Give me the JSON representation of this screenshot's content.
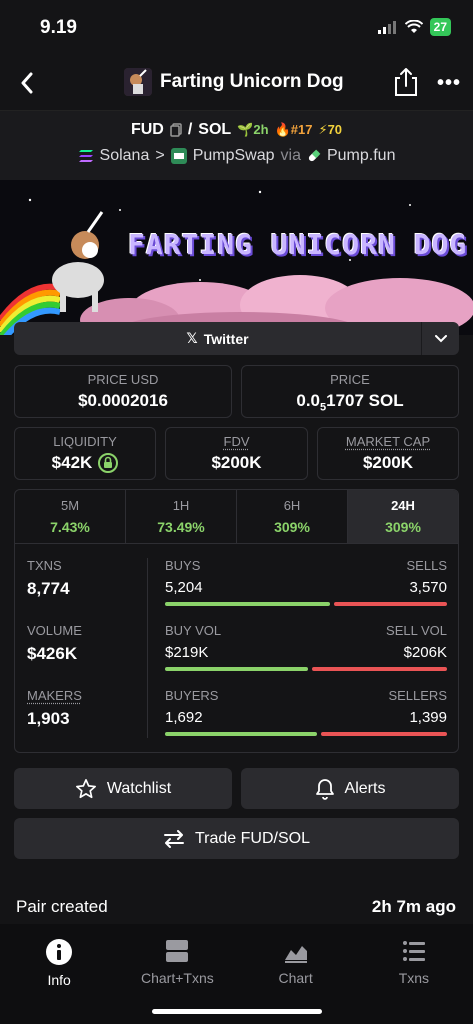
{
  "status": {
    "time": "9.19",
    "battery": "27"
  },
  "nav": {
    "title": "Farting Unicorn Dog"
  },
  "pair": {
    "base": "FUD",
    "sep": "/",
    "quote": "SOL",
    "age": "2h",
    "rank": "#17",
    "boosts": "70"
  },
  "chain": {
    "network": "Solana",
    "sep": ">",
    "dex": "PumpSwap",
    "via": "via",
    "launchpad": "Pump.fun"
  },
  "banner": {
    "text": "FARTING UNICORN DOG"
  },
  "twitter": {
    "label": "Twitter"
  },
  "price": {
    "usd_label": "PRICE USD",
    "usd_value": "$0.0002016",
    "native_label": "PRICE",
    "native_prefix": "0.0",
    "native_zeros": "5",
    "native_rest": "1707 SOL"
  },
  "metrics": {
    "liquidity_label": "LIQUIDITY",
    "liquidity_value": "$42K",
    "fdv_label": "FDV",
    "fdv_value": "$200K",
    "mcap_label": "MARKET CAP",
    "mcap_value": "$200K"
  },
  "timeframes": [
    {
      "label": "5M",
      "change": "7.43%"
    },
    {
      "label": "1H",
      "change": "73.49%"
    },
    {
      "label": "6H",
      "change": "309%"
    },
    {
      "label": "24H",
      "change": "309%"
    }
  ],
  "stats": {
    "txns_label": "TXNS",
    "txns_value": "8,774",
    "volume_label": "VOLUME",
    "volume_value": "$426K",
    "makers_label": "MAKERS",
    "makers_value": "1,903",
    "buys_label": "BUYS",
    "buys_value": "5,204",
    "sells_label": "SELLS",
    "sells_value": "3,570",
    "buyvol_label": "BUY VOL",
    "buyvol_value": "$219K",
    "sellvol_label": "SELL VOL",
    "sellvol_value": "$206K",
    "buyers_label": "BUYERS",
    "buyers_value": "1,692",
    "sellers_label": "SELLERS",
    "sellers_value": "1,399"
  },
  "actions": {
    "watchlist": "Watchlist",
    "alerts": "Alerts",
    "trade": "Trade FUD/SOL"
  },
  "pair_created": {
    "label": "Pair created",
    "value": "2h 7m ago"
  },
  "bottom_nav": [
    {
      "label": "Info"
    },
    {
      "label": "Chart+Txns"
    },
    {
      "label": "Chart"
    },
    {
      "label": "Txns"
    }
  ]
}
